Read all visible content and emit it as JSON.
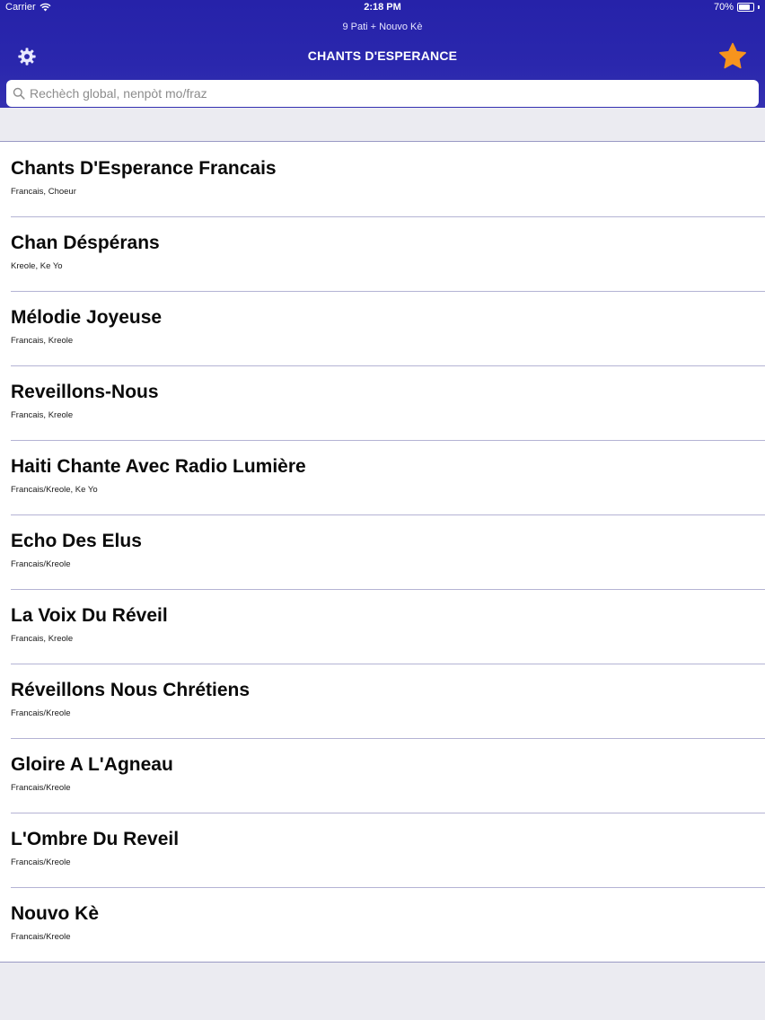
{
  "status_bar": {
    "carrier": "Carrier",
    "time": "2:18 PM",
    "battery": "70%"
  },
  "header": {
    "subtitle": "9 Pati + Nouvo Kè",
    "title": "CHANTS D'ESPERANCE",
    "left_icon": "gear-icon",
    "right_icon": "star-icon",
    "star_color": "#f7941d"
  },
  "search": {
    "placeholder": "Rechèch global, nenpòt mo/fraz",
    "value": ""
  },
  "books": [
    {
      "title": "Chants D'Esperance Francais",
      "subtitle": "Francais, Choeur"
    },
    {
      "title": "Chan Déspérans",
      "subtitle": "Kreole, Ke Yo"
    },
    {
      "title": "Mélodie Joyeuse",
      "subtitle": "Francais, Kreole"
    },
    {
      "title": "Reveillons-Nous",
      "subtitle": "Francais, Kreole"
    },
    {
      "title": "Haiti Chante Avec Radio Lumière",
      "subtitle": "Francais/Kreole, Ke Yo"
    },
    {
      "title": "Echo Des Elus",
      "subtitle": "Francais/Kreole"
    },
    {
      "title": "La Voix Du Réveil",
      "subtitle": "Francais, Kreole"
    },
    {
      "title": "Réveillons Nous Chrétiens",
      "subtitle": "Francais/Kreole"
    },
    {
      "title": "Gloire A L'Agneau",
      "subtitle": "Francais/Kreole"
    },
    {
      "title": "L'Ombre Du Reveil",
      "subtitle": "Francais/Kreole"
    },
    {
      "title": "Nouvo Kè",
      "subtitle": "Francais/Kreole"
    }
  ],
  "colors": {
    "header_bg": "#2823aa",
    "divider": "#b4b3d4",
    "background": "#ebebf1"
  }
}
